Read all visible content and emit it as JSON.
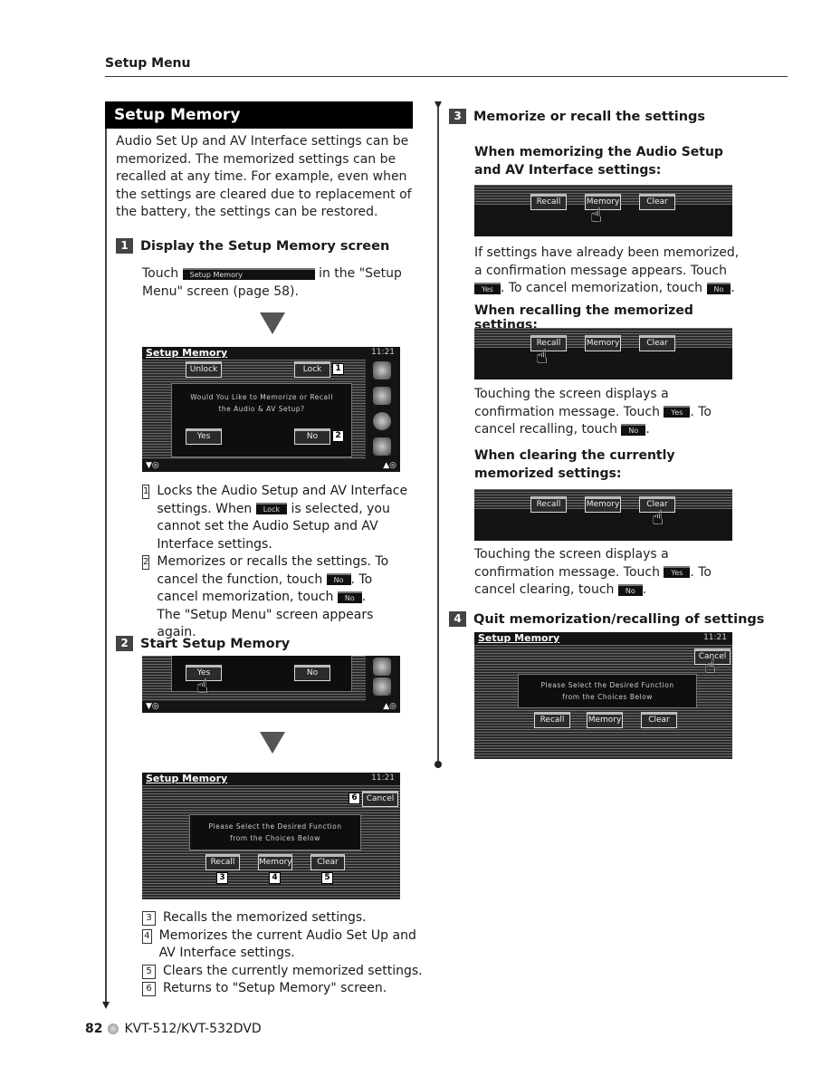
{
  "header": {
    "section_title": "Setup Menu"
  },
  "left": {
    "section_bar": "Setup Memory",
    "intro": "Audio Set Up and AV Interface settings can be memorized. The memorized settings can be recalled at any time. For example, even when the settings are cleared due to replacement of the battery, the settings can be restored.",
    "step1": {
      "num": "1",
      "title": "Display the Setup Memory screen",
      "text_before": "Touch",
      "chip": "Setup Memory",
      "text_after": "in the \"Setup Menu\" screen (page 58)."
    },
    "screen1": {
      "title": "Setup Memory",
      "clock": "11:21",
      "unlock": "Unlock",
      "lock": "Lock",
      "message_line1": "Would You Like to Memorize or Recall",
      "message_line2": "the Audio & AV Setup?",
      "yes": "Yes",
      "no": "No",
      "callout1": "1",
      "callout2": "2"
    },
    "notes1": [
      {
        "num": "1",
        "parts": [
          "Locks the Audio Setup and AV Interface settings. When ",
          "Lock",
          " is selected, you cannot set the Audio Setup and AV Interface settings."
        ]
      },
      {
        "num": "2",
        "parts": [
          "Memorizes or recalls the settings. To cancel the function, touch ",
          "No",
          ". To cancel memorization, touch ",
          "No",
          ".",
          "The \"Setup Menu\" screen appears again."
        ]
      }
    ],
    "step2": {
      "num": "2",
      "title": "Start Setup Memory"
    },
    "screen2": {
      "yes": "Yes",
      "no": "No"
    },
    "screen3": {
      "title": "Setup Memory",
      "clock": "11:21",
      "cancel": "Cancel",
      "message_line1": "Please Select the Desired Function",
      "message_line2": "from the Choices Below",
      "recall": "Recall",
      "memory": "Memory",
      "clear": "Clear",
      "callout3": "3",
      "callout4": "4",
      "callout5": "5",
      "callout6": "6"
    },
    "notes2": [
      {
        "num": "3",
        "text": "Recalls the memorized settings."
      },
      {
        "num": "4",
        "text": "Memorizes the current Audio Set Up and AV Interface settings."
      },
      {
        "num": "5",
        "text": "Clears the currently memorized settings."
      },
      {
        "num": "6",
        "text": "Returns to \"Setup Memory\" screen."
      }
    ]
  },
  "right": {
    "step3": {
      "num": "3",
      "title": "Memorize or recall the settings"
    },
    "memorizing": {
      "heading": "When memorizing the Audio Setup and AV Interface settings:",
      "buttons": [
        "Recall",
        "Memory",
        "Clear"
      ],
      "text1": "If settings have already been memorized, a confirmation message appears. Touch",
      "chip_yes": "Yes",
      "text2": ". To cancel memorization, touch",
      "chip_no": "No",
      "text3": "."
    },
    "recalling": {
      "heading": "When recalling the memorized settings:",
      "buttons": [
        "Recall",
        "Memory",
        "Clear"
      ],
      "text1": "Touching the screen displays a confirmation message. Touch",
      "chip_yes": "Yes",
      "text2": ". To cancel recalling, touch",
      "chip_no": "No",
      "text3": "."
    },
    "clearing": {
      "heading": "When clearing the currently memorized settings:",
      "buttons": [
        "Recall",
        "Memory",
        "Clear"
      ],
      "text1": "Touching the screen displays a confirmation message. Touch",
      "chip_yes": "Yes",
      "text2": ". To cancel clearing, touch",
      "chip_no": "No",
      "text3": "."
    },
    "step4": {
      "num": "4",
      "title": "Quit memorization/recalling of settings"
    },
    "screen4": {
      "title": "Setup Memory",
      "clock": "11:21",
      "cancel": "Cancel",
      "message_line1": "Please Select the Desired Function",
      "message_line2": "from the Choices Below",
      "recall": "Recall",
      "memory": "Memory",
      "clear": "Clear"
    }
  },
  "footer": {
    "page_number": "82",
    "model": "KVT-512/KVT-532DVD"
  }
}
